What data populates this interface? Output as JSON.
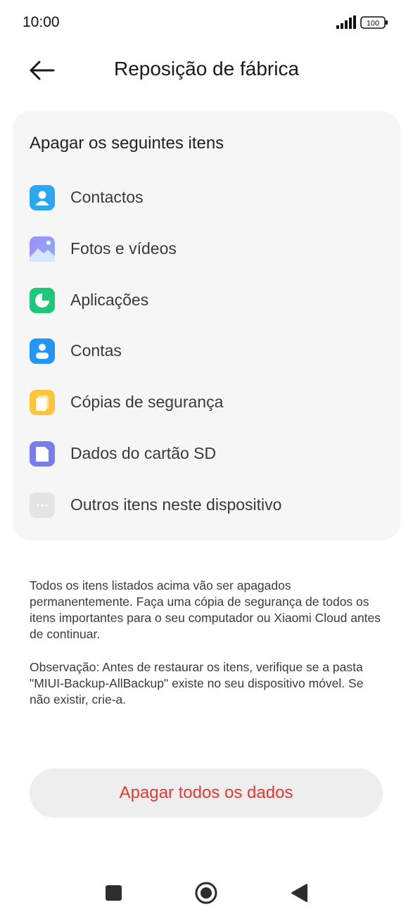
{
  "status_bar": {
    "time": "10:00",
    "battery": "100"
  },
  "header": {
    "title": "Reposição de fábrica"
  },
  "card": {
    "title": "Apagar os seguintes itens",
    "items": [
      {
        "label": "Contactos",
        "icon": "contacts-icon",
        "color": "#2aa7f0"
      },
      {
        "label": "Fotos e vídeos",
        "icon": "gallery-icon",
        "color": "#8f8ff5"
      },
      {
        "label": "Aplicações",
        "icon": "apps-pie-icon",
        "color": "#1ec77a"
      },
      {
        "label": "Contas",
        "icon": "account-icon",
        "color": "#2196f3"
      },
      {
        "label": "Cópias de segurança",
        "icon": "backup-icon",
        "color": "#ffc43d"
      },
      {
        "label": "Dados do cartão SD",
        "icon": "sd-card-icon",
        "color": "#7b7bf0"
      },
      {
        "label": "Outros itens neste dispositivo",
        "icon": "more-dots-icon",
        "color": "#e4e4e4"
      }
    ]
  },
  "notes": {
    "warning": "Todos os itens listados acima vão ser apagados permanentemente. Faça uma cópia de segurança de todos os itens importantes para o seu computador ou Xiaomi Cloud antes de continuar.",
    "observation": "Observação: Antes de restaurar os itens, verifique se a pasta \"MIUI-Backup-AllBackup\" existe no seu dispositivo móvel. Se não existir, crie-a."
  },
  "action": {
    "label": "Apagar todos os dados",
    "color": "#e53935"
  },
  "navbar": {
    "buttons": [
      "recents-square-icon",
      "home-circle-icon",
      "back-triangle-icon"
    ]
  }
}
